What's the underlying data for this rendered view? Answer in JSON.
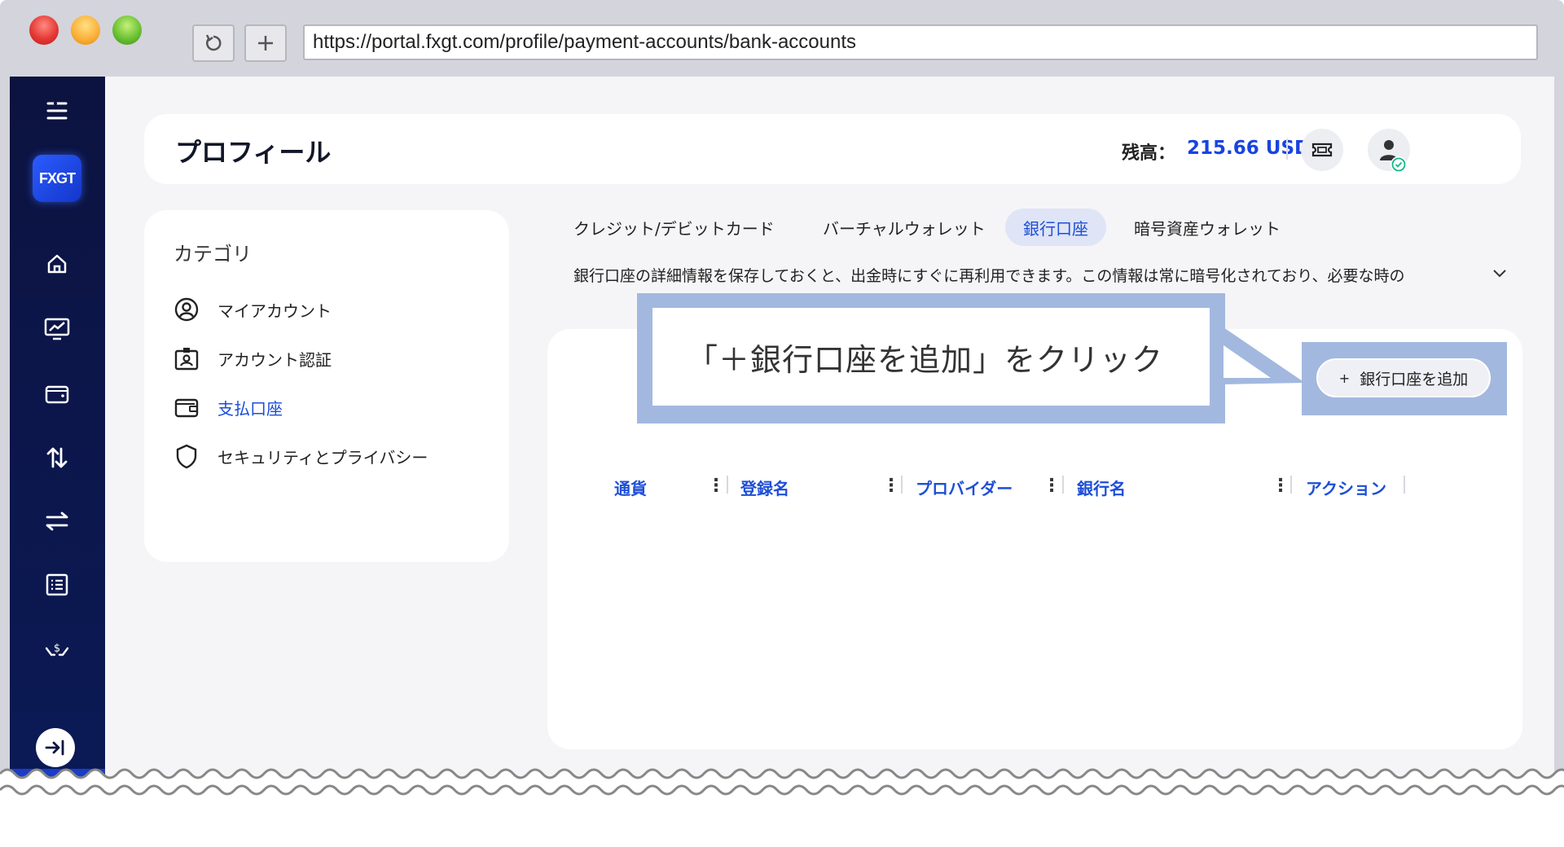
{
  "browser": {
    "url": "https://portal.fxgt.com/profile/payment-accounts/bank-accounts",
    "reload_icon": "reload-icon",
    "new_tab_icon": "plus-icon"
  },
  "sidebar": {
    "logo_text": "FXGT",
    "icons": [
      "menu-icon",
      "home-icon",
      "chart-icon",
      "wallet-icon",
      "transfer-vertical-icon",
      "transfer-horizontal-icon",
      "list-icon",
      "hands-dollar-icon",
      "collapse-arrow-icon"
    ]
  },
  "header": {
    "title": "プロフィール",
    "balance_label": "残高：",
    "balance_value": "215.66 USD"
  },
  "categories": {
    "title": "カテゴリ",
    "items": [
      {
        "label": "マイアカウント",
        "icon": "user-circle-icon"
      },
      {
        "label": "アカウント認証",
        "icon": "id-card-icon"
      },
      {
        "label": "支払口座",
        "icon": "wallet-icon",
        "active": true
      },
      {
        "label": "セキュリティとプライバシー",
        "icon": "shield-icon"
      }
    ]
  },
  "tabs": [
    {
      "label": "クレジット/デビットカード"
    },
    {
      "label": "バーチャルウォレット"
    },
    {
      "label": "銀行口座",
      "active": true
    },
    {
      "label": "暗号資産ウォレット"
    }
  ],
  "info": {
    "text": "銀行口座の詳細情報を保存しておくと、出金時にすぐに再利用できます。この情報は常に暗号化されており、必要な時の"
  },
  "main": {
    "add_button_label": "銀行口座を追加",
    "add_button_plus": "+",
    "columns": [
      "通貨",
      "登録名",
      "プロバイダー",
      "銀行名",
      "アクション"
    ]
  },
  "callout": {
    "text": "「＋銀行口座を追加」をクリック"
  },
  "colors": {
    "accent": "#1d4ed8",
    "sidebar": "#0c1340",
    "highlight": "#a3b8df"
  }
}
